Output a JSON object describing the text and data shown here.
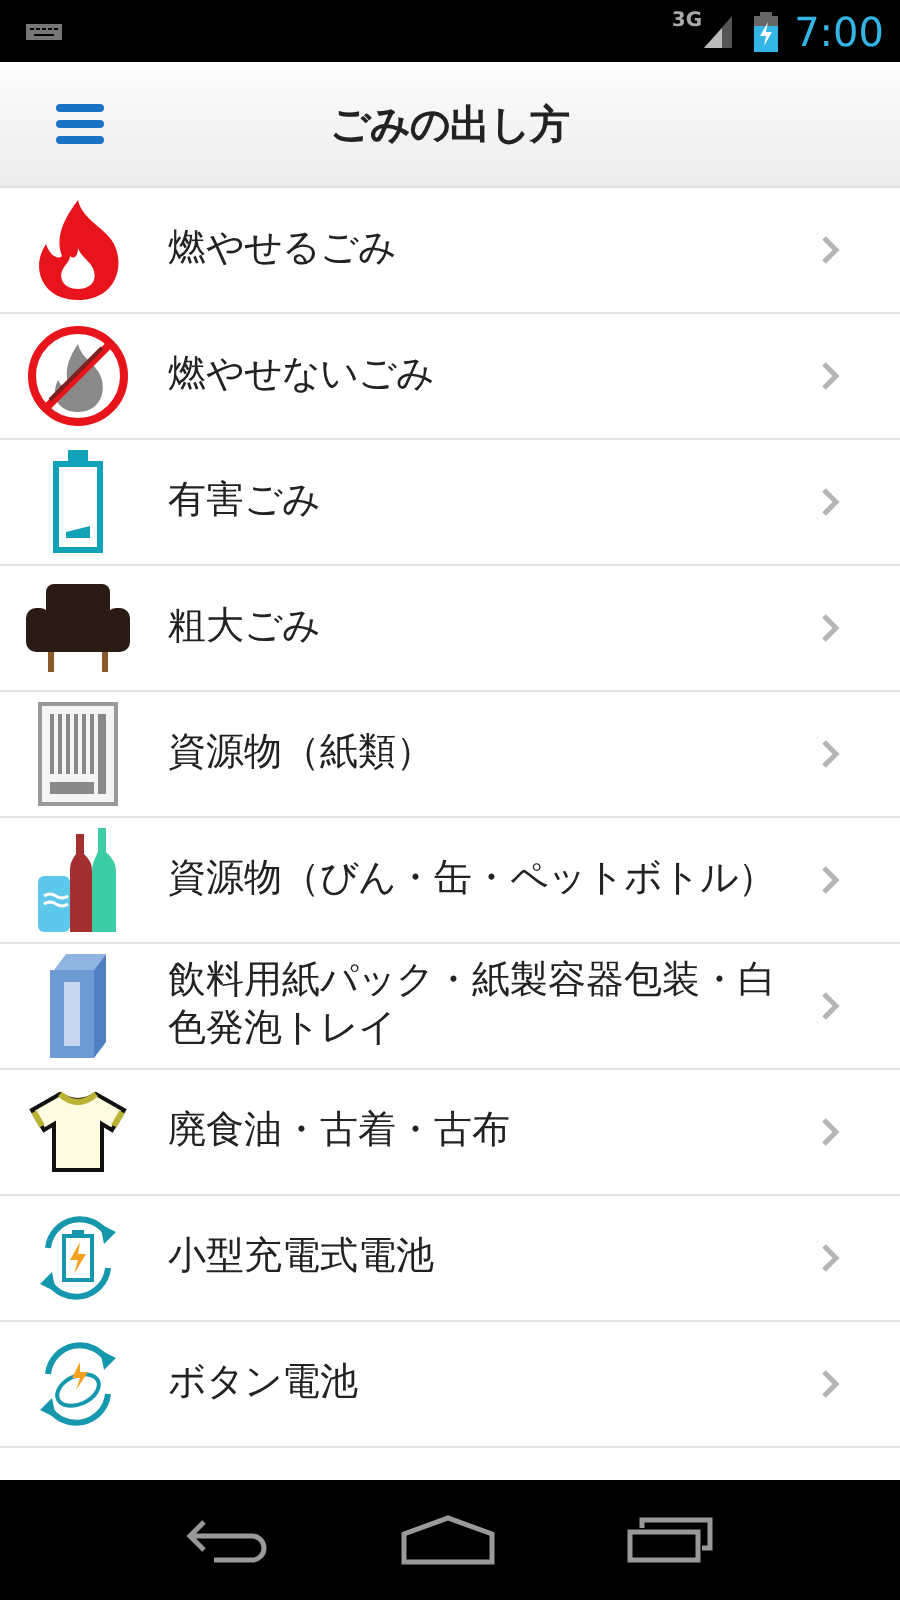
{
  "status_bar": {
    "network": "3G",
    "time": "7:00"
  },
  "header": {
    "title": "ごみの出し方"
  },
  "items": [
    {
      "label": "燃やせるごみ",
      "kind": "fire"
    },
    {
      "label": "燃やせないごみ",
      "kind": "nofire"
    },
    {
      "label": "有害ごみ",
      "kind": "battery"
    },
    {
      "label": "粗大ごみ",
      "kind": "sofa"
    },
    {
      "label": "資源物（紙類）",
      "kind": "paper"
    },
    {
      "label": "資源物（びん・缶・ペットボトル）",
      "kind": "bottles"
    },
    {
      "label": "飲料用紙パック・紙製容器包装・白色発泡トレイ",
      "kind": "milk"
    },
    {
      "label": "廃食油・古着・古布",
      "kind": "shirt"
    },
    {
      "label": "小型充電式電池",
      "kind": "recharge"
    },
    {
      "label": "ボタン電池",
      "kind": "button"
    }
  ]
}
